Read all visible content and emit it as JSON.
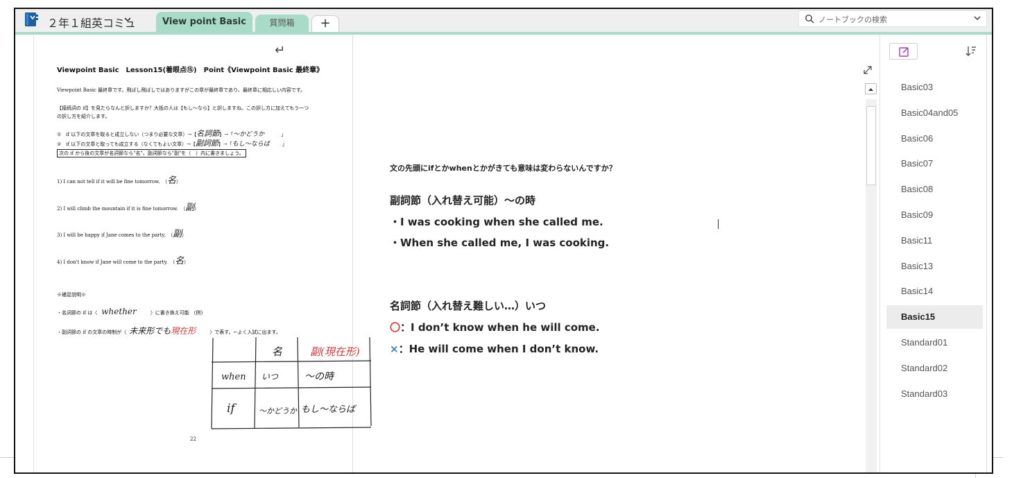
{
  "header": {
    "notebook_title": "２年１組英コミュ",
    "tabs": [
      {
        "label": "View point Basic",
        "active": true
      },
      {
        "label": "質問箱",
        "active": false
      },
      {
        "label": "+",
        "active": false
      }
    ],
    "search_placeholder": "ノートブックの検索",
    "accent_color": "#a8dcc8"
  },
  "document": {
    "title": "Viewpoint Basic　Lesson15(着眼点⑮)　Point《Viewpoint Basic 最終章》",
    "intro": "Viewpoint Basic 最終章です。飛ばし飛ばしではありますがこの章が最終章であり、最終章に相応しい内容です。",
    "para1": "【接続詞の if】を見たらなんと訳しますか？大抵の人は【もし～なら】と訳しますね。この訳し方に加えてもう一つ",
    "para2": "の訳し方を紹介します。",
    "rule1": "①　if 以下の文章を取ると成立しない（つまり必要な文章）→【",
    "rule1_fill": "名詞節",
    "rule1_mid": "】→「",
    "rule1_fill2": "～かどうか",
    "rule1_end": "」",
    "rule2": "②　if 以下の文章と取っても成立する（なくてもよい文章）→【",
    "rule2_fill": "副詞節",
    "rule2_mid": "】→「",
    "rule2_fill2": "もし～ならば",
    "rule2_end": "」",
    "instruction": "次の if から後の文章が名詞節なら\"名\"、副詞節なら\"副\"を（　）内に書きましょう。",
    "q1": "1) I can not tell if it will be fine tomorrow.　（",
    "q1_ans": "名",
    "q2": "2) I will climb the mountain if it is fine tomorrow.　（",
    "q2_ans": "副",
    "q3": "3) I will be happy if Jane comes to the party.　（",
    "q3_ans": "副",
    "q4": "4) I don't know if Jane will come to the party.　（",
    "q4_ans": "名",
    "close_paren": "）",
    "supp_title": "※補足説明※",
    "supp1": "・名詞節の if は〈",
    "supp1_fill": "whether",
    "supp1_end": "〉に書き換え可能　(例)",
    "supp2": "・副詞節の if の文章の時制が〈",
    "supp2_fill": "未来形でも",
    "supp2_fill_red": "現在形",
    "supp2_end": "〉で表す。←よく入試に出ます。",
    "page_number": "22",
    "hand_table": {
      "header": [
        "名",
        "副(現在形)"
      ],
      "rows": [
        {
          "label": "when",
          "cells": [
            "いつ",
            "～の時"
          ]
        },
        {
          "label": "if",
          "cells": [
            "～かどうか",
            "もし～ならば"
          ]
        }
      ]
    }
  },
  "note": {
    "question": "文の先頭にifとかwhenとかがきても意味は変わらないんですか？",
    "heading1": "副詞節（入れ替え可能）～の時",
    "line1": "・I was cooking when she called me.",
    "line2": "・When she called me, I was cooking.",
    "heading2": "名詞節（入れ替え難しい…）いつ",
    "ok_mark": "〇",
    "ok_line": "：I don’t know when he will come.",
    "ng_mark": "×",
    "ng_line": "：He will come when I don’t know."
  },
  "sidebar": {
    "pages": [
      "Basic03",
      "Basic04and05",
      "Basic06",
      "Basic07",
      "Basic08",
      "Basic09",
      "Basic11",
      "Basic13",
      "Basic14",
      "Basic15",
      "Standard01",
      "Standard02",
      "Standard03"
    ],
    "active_page": "Basic15"
  }
}
